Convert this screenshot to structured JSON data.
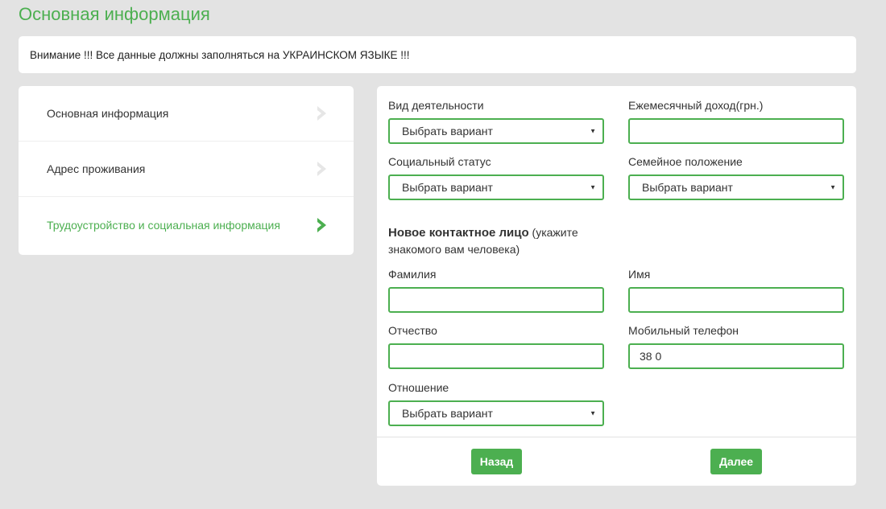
{
  "page_title": "Основная информация",
  "notice": "Внимание !!! Все данные должны заполняться на УКРАИНСКОМ ЯЗЫКЕ !!!",
  "sidebar": {
    "items": [
      {
        "label": "Основная информация",
        "active": false
      },
      {
        "label": "Адрес проживания",
        "active": false
      },
      {
        "label": "Трудоустройство и социальная информация",
        "active": true
      }
    ]
  },
  "form": {
    "activity": {
      "label": "Вид деятельности",
      "value": "Выбрать вариант"
    },
    "income": {
      "label": "Ежемесячный доход(грн.)",
      "value": ""
    },
    "social_status": {
      "label": "Социальный статус",
      "value": "Выбрать вариант"
    },
    "marital_status": {
      "label": "Семейное положение",
      "value": "Выбрать вариант"
    },
    "contact_heading_bold": "Новое контактное лицо",
    "contact_heading_note": " (укажите знакомого вам человека)",
    "last_name": {
      "label": "Фамилия",
      "value": ""
    },
    "first_name": {
      "label": "Имя",
      "value": ""
    },
    "patronymic": {
      "label": "Отчество",
      "value": ""
    },
    "mobile": {
      "label": "Мобильный телефон",
      "value": "38 0"
    },
    "relation": {
      "label": "Отношение",
      "value": "Выбрать вариант"
    }
  },
  "buttons": {
    "back": "Назад",
    "next": "Далее"
  },
  "colors": {
    "accent": "#4caf50",
    "background": "#e3e3e3",
    "inactive_chevron": "#e6e6e6"
  },
  "icons": {
    "chevron": "chevron-right-icon",
    "caret": "caret-down-icon"
  }
}
